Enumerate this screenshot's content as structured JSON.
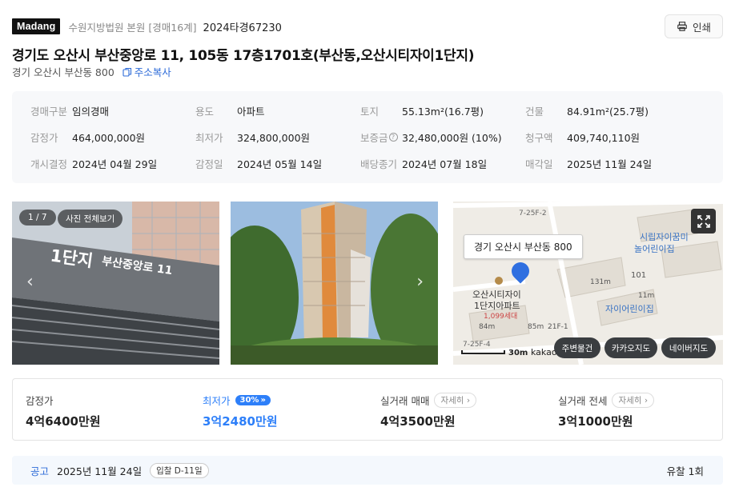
{
  "header": {
    "logo": "Madang",
    "court": "수원지방법원 본원 [경매16계]",
    "case_no": "2024타경67230",
    "print_label": "인쇄"
  },
  "title": "경기도 오산시 부산중앙로 11, 105동 17층1701호(부산동,오산시티자이1단지)",
  "sub_address": "경기 오산시 부산동 800",
  "copy_label": "주소복사",
  "info": {
    "row1": [
      {
        "label": "경매구분",
        "value": "임의경매"
      },
      {
        "label": "용도",
        "value": "아파트"
      },
      {
        "label": "토지",
        "value": "55.13m²(16.7평)"
      },
      {
        "label": "건물",
        "value": "84.91m²(25.7평)"
      }
    ],
    "row2": [
      {
        "label": "감정가",
        "value": "464,000,000원"
      },
      {
        "label": "최저가",
        "value": "324,800,000원"
      },
      {
        "label": "보증금",
        "value": "32,480,000원 (10%)"
      },
      {
        "label": "청구액",
        "value": "409,740,110원"
      }
    ],
    "row3": [
      {
        "label": "개시결정",
        "value": "2024년 04월 29일"
      },
      {
        "label": "감정일",
        "value": "2024년 05월 14일"
      },
      {
        "label": "배당종기",
        "value": "2024년 07월 18일"
      },
      {
        "label": "매각일",
        "value": "2025년 11월 24일"
      }
    ]
  },
  "photos": {
    "counter": "1 / 7",
    "view_all": "사진 전체보기",
    "sign_text1": "1단지",
    "sign_text2": "부산중앙로 11"
  },
  "map": {
    "address_label": "경기 오산시 부산동 800",
    "labels": {
      "complex": "오산시티자이",
      "complex2": "1단지아파트",
      "households": "1,099세대",
      "kinder1": "시립자이꿈미",
      "kinder1b": "놀어린이집",
      "kinder2": "자이어린이집",
      "bldg101": "101",
      "road1": "7-25F-2",
      "road2": "7-25F-4",
      "d131": "131m",
      "d11": "11m",
      "d84": "84m",
      "d85": "85m",
      "d21": "21F-1",
      "scale": "30m",
      "kakao": "kakao"
    },
    "buttons": [
      "주변물건",
      "카카오지도",
      "네이버지도"
    ]
  },
  "prices": [
    {
      "label": "감정가",
      "value": "4억6400만원"
    },
    {
      "label": "최저가",
      "value": "3억2480만원",
      "badge": "30%"
    },
    {
      "label": "실거래 매매",
      "value": "4억3500만원",
      "detail": "자세히"
    },
    {
      "label": "실거래 전세",
      "value": "3억1000만원",
      "detail": "자세히"
    }
  ],
  "notice": {
    "label": "공고",
    "date": "2025년 11월 24일",
    "dday": "입찰 D-11일",
    "fail": "유찰 1회"
  },
  "colors": {
    "accent": "#2d7ff9",
    "link": "#2d6bd8"
  }
}
